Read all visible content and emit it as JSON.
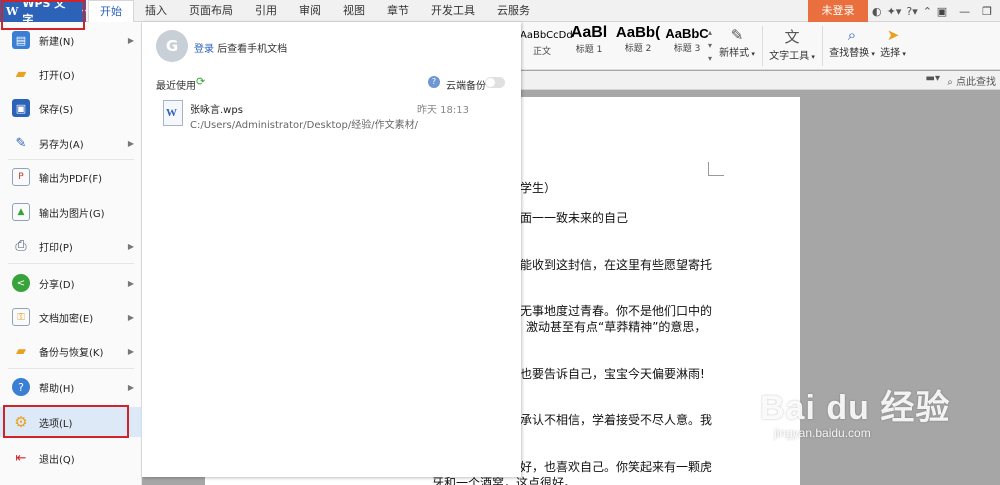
{
  "app": {
    "logo": "W",
    "name": "WPS 文字",
    "dropdown": "▾"
  },
  "tabs": [
    "开始",
    "插入",
    "页面布局",
    "引用",
    "审阅",
    "视图",
    "章节",
    "开发工具",
    "云服务"
  ],
  "topbar": {
    "login": "未登录",
    "icons": [
      "◐",
      "✦▾",
      "?▾",
      "⌃"
    ],
    "window": [
      "▣",
      "—",
      "❐"
    ]
  },
  "ribbon": {
    "styles": [
      {
        "preview": "AaBbCcDd",
        "name": "正文"
      },
      {
        "preview": "AaBl",
        "name": "标题 1"
      },
      {
        "preview": "AaBb(",
        "name": "标题 2"
      },
      {
        "preview": "AaBbC",
        "name": "标题 3"
      }
    ],
    "new_style": "新样式",
    "text_tools": "文字工具",
    "find_replace": "查找替换",
    "select": "选择",
    "search_hint": "点此查找"
  },
  "menu": {
    "items": [
      {
        "label": "新建(N)",
        "icon": "new-icon",
        "arrow": true
      },
      {
        "label": "打开(O)",
        "icon": "open-icon",
        "arrow": false
      },
      {
        "label": "保存(S)",
        "icon": "save-icon",
        "arrow": false
      },
      {
        "label": "另存为(A)",
        "icon": "save-as-icon",
        "arrow": true
      },
      {
        "label": "输出为PDF(F)",
        "icon": "pdf-icon",
        "arrow": false
      },
      {
        "label": "输出为图片(G)",
        "icon": "image-icon",
        "arrow": false
      },
      {
        "label": "打印(P)",
        "icon": "print-icon",
        "arrow": true
      },
      {
        "label": "分享(D)",
        "icon": "share-icon",
        "arrow": true
      },
      {
        "label": "文档加密(E)",
        "icon": "encrypt-icon",
        "arrow": true
      },
      {
        "label": "备份与恢复(K)",
        "icon": "backup-icon",
        "arrow": true
      },
      {
        "label": "帮助(H)",
        "icon": "help-icon",
        "arrow": true
      },
      {
        "label": "选项(L)",
        "icon": "gear-icon",
        "arrow": false
      },
      {
        "label": "退出(Q)",
        "icon": "exit-icon",
        "arrow": false
      }
    ],
    "arrow_glyph": "▶"
  },
  "panel": {
    "avatar_letter": "G",
    "login_link": "登录",
    "login_text": "后查看手机文档",
    "recent_label": "最近使用",
    "help": "?",
    "cloud_backup": "云端备份",
    "file": {
      "name": "张咏言.wps",
      "path": "C:/Users/Administrator/Desktop/经验/作文素材/",
      "time": "昨天 18:13"
    }
  },
  "document": {
    "lines": [
      "学生）",
      "面一一致未来的自己",
      "能收到这封信，在这里有些愿望寄托",
      "无事地度过青春。你不是他们口中的",
      "。激动甚至有点“草莽精神”的意思，",
      "也要告诉自己，宝宝今天偏要淋雨!",
      "承认不相信，学着接受不尽人意。我",
      "。",
      "好，也喜欢自己。你笑起来有一颗虎",
      "牙和一个酒窝，这点很好。"
    ]
  },
  "watermark": {
    "brand": "Bai du 经验",
    "url": "jingyan.baidu.com"
  }
}
